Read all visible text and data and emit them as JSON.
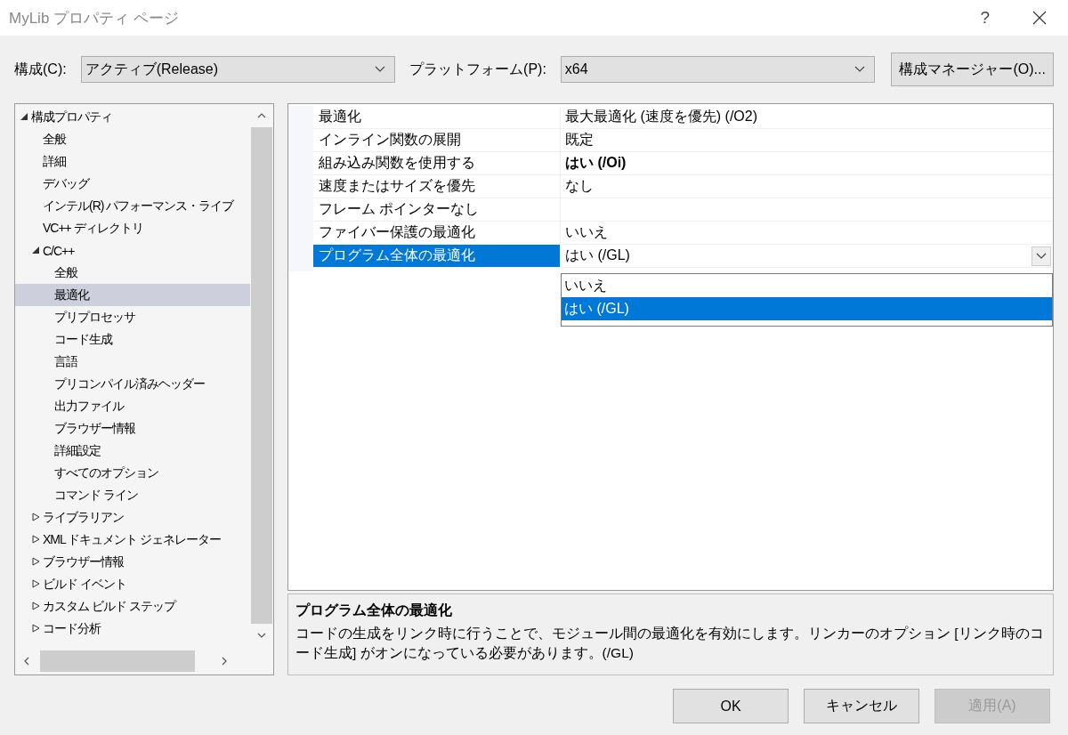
{
  "window": {
    "title": "MyLib プロパティ ページ",
    "help": "?"
  },
  "config": {
    "label": "構成(C):",
    "value": "アクティブ(Release)"
  },
  "platform": {
    "label": "プラットフォーム(P):",
    "value": "x64"
  },
  "config_manager": {
    "label": "構成マネージャー(O)..."
  },
  "tree": [
    {
      "label": "構成プロパティ",
      "expanded": true,
      "selected": false,
      "children": [
        {
          "label": "全般",
          "selected": false
        },
        {
          "label": "詳細",
          "selected": false
        },
        {
          "label": "デバッグ",
          "selected": false
        },
        {
          "label": "インテル(R) パフォーマンス・ライブ",
          "selected": false
        },
        {
          "label": "VC++ ディレクトリ",
          "selected": false
        },
        {
          "label": "C/C++",
          "expanded": true,
          "selected": false,
          "children": [
            {
              "label": "全般",
              "selected": false
            },
            {
              "label": "最適化",
              "selected": true
            },
            {
              "label": "プリプロセッサ",
              "selected": false
            },
            {
              "label": "コード生成",
              "selected": false
            },
            {
              "label": "言語",
              "selected": false
            },
            {
              "label": "プリコンパイル済みヘッダー",
              "selected": false
            },
            {
              "label": "出力ファイル",
              "selected": false
            },
            {
              "label": "ブラウザー情報",
              "selected": false
            },
            {
              "label": "詳細設定",
              "selected": false
            },
            {
              "label": "すべてのオプション",
              "selected": false
            },
            {
              "label": "コマンド ライン",
              "selected": false
            }
          ]
        },
        {
          "label": "ライブラリアン",
          "expanded": false,
          "selected": false
        },
        {
          "label": "XML ドキュメント ジェネレーター",
          "expanded": false,
          "selected": false
        },
        {
          "label": "ブラウザー情報",
          "expanded": false,
          "selected": false
        },
        {
          "label": "ビルド イベント",
          "expanded": false,
          "selected": false
        },
        {
          "label": "カスタム ビルド ステップ",
          "expanded": false,
          "selected": false
        },
        {
          "label": "コード分析",
          "expanded": false,
          "selected": false
        }
      ]
    }
  ],
  "properties": [
    {
      "name": "最適化",
      "value": "最大最適化 (速度を優先) (/O2)",
      "modified": false,
      "selected": false
    },
    {
      "name": "インライン関数の展開",
      "value": "既定",
      "modified": false,
      "selected": false
    },
    {
      "name": "組み込み関数を使用する",
      "value": "はい (/Oi)",
      "modified": true,
      "selected": false
    },
    {
      "name": "速度またはサイズを優先",
      "value": "なし",
      "modified": false,
      "selected": false
    },
    {
      "name": "フレーム ポインターなし",
      "selected": false
    },
    {
      "name": "ファイバー保護の最適化",
      "value": "いいえ",
      "modified": false,
      "selected": false
    },
    {
      "name": "プログラム全体の最適化",
      "value": "はい (/GL)",
      "modified": false,
      "selected": true
    }
  ],
  "dropdown_options": [
    {
      "label": "いいえ",
      "selected": false
    },
    {
      "label": "はい (/GL)",
      "selected": true
    }
  ],
  "description": {
    "title": "プログラム全体の最適化",
    "text": "コードの生成をリンク時に行うことで、モジュール間の最適化を有効にします。リンカーのオプション [リンク時のコード生成] がオンになっている必要があります。(/GL)"
  },
  "buttons": [
    {
      "label": "OK",
      "disabled": false
    },
    {
      "label": "キャンセル",
      "disabled": false
    },
    {
      "label": "適用(A)",
      "disabled": true
    }
  ]
}
